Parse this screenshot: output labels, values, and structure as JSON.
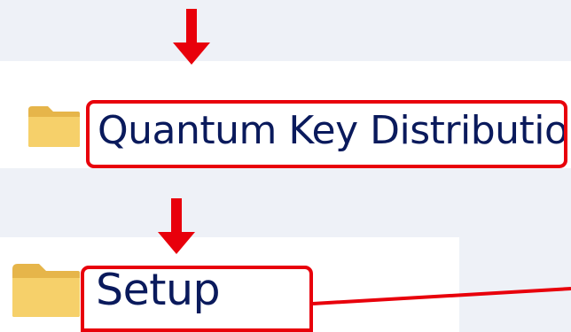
{
  "items": [
    {
      "label": "Quantum Key Distribution",
      "icon": "folder-icon",
      "highlighted": true
    },
    {
      "label": "Setup",
      "icon": "folder-icon",
      "highlighted": true
    }
  ],
  "colors": {
    "highlight": "#e8000b",
    "arrow": "#e8000b",
    "folder": "#f3c95c",
    "text": "#0a1a5c",
    "background": "#eef1f7"
  }
}
